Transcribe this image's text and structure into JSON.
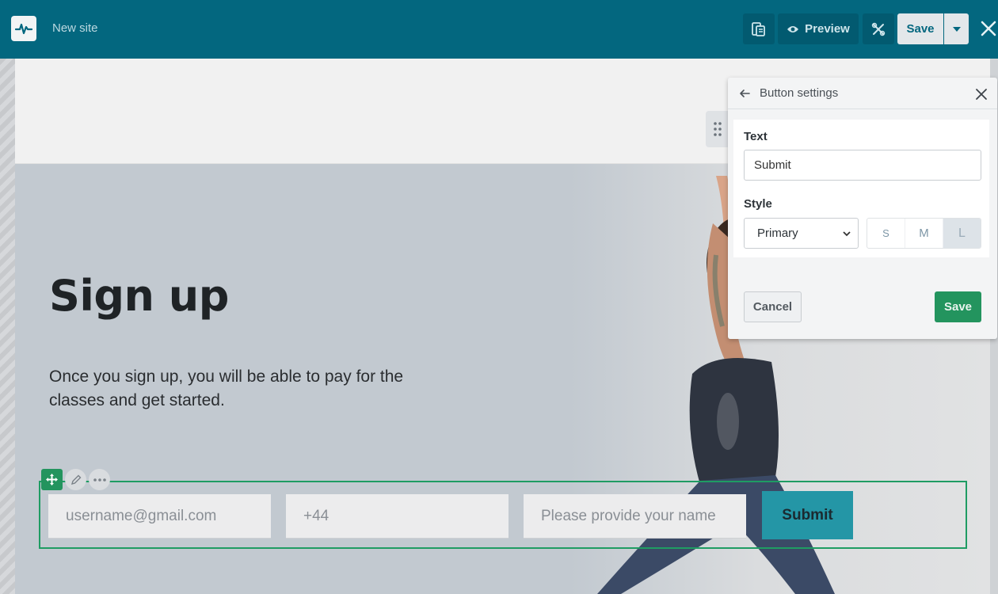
{
  "topbar": {
    "site_name": "New site",
    "preview_label": "Preview",
    "save_label": "Save",
    "colors": {
      "bar": "#03677f",
      "button": "#025a70"
    }
  },
  "page": {
    "title": "Sign up",
    "description": "Once you sign up, you will be able to pay for the classes and get started.",
    "form": {
      "email_placeholder": "username@gmail.com",
      "phone_placeholder": "+44",
      "name_placeholder": "Please provide your name",
      "submit_label": "Submit"
    }
  },
  "panel": {
    "title": "Button settings",
    "text_label": "Text",
    "text_value": "Submit",
    "style_label": "Style",
    "style_value": "Primary",
    "sizes": [
      "S",
      "M",
      "L"
    ],
    "active_size": "L",
    "cancel_label": "Cancel",
    "save_label": "Save"
  },
  "icons": [
    "logo-pulse-icon",
    "pages-icon",
    "eye-icon",
    "tools-icon",
    "chevron-down-icon",
    "close-icon",
    "back-arrow-icon",
    "drag-handle-icon",
    "move-icon",
    "pencil-icon",
    "more-icon"
  ]
}
